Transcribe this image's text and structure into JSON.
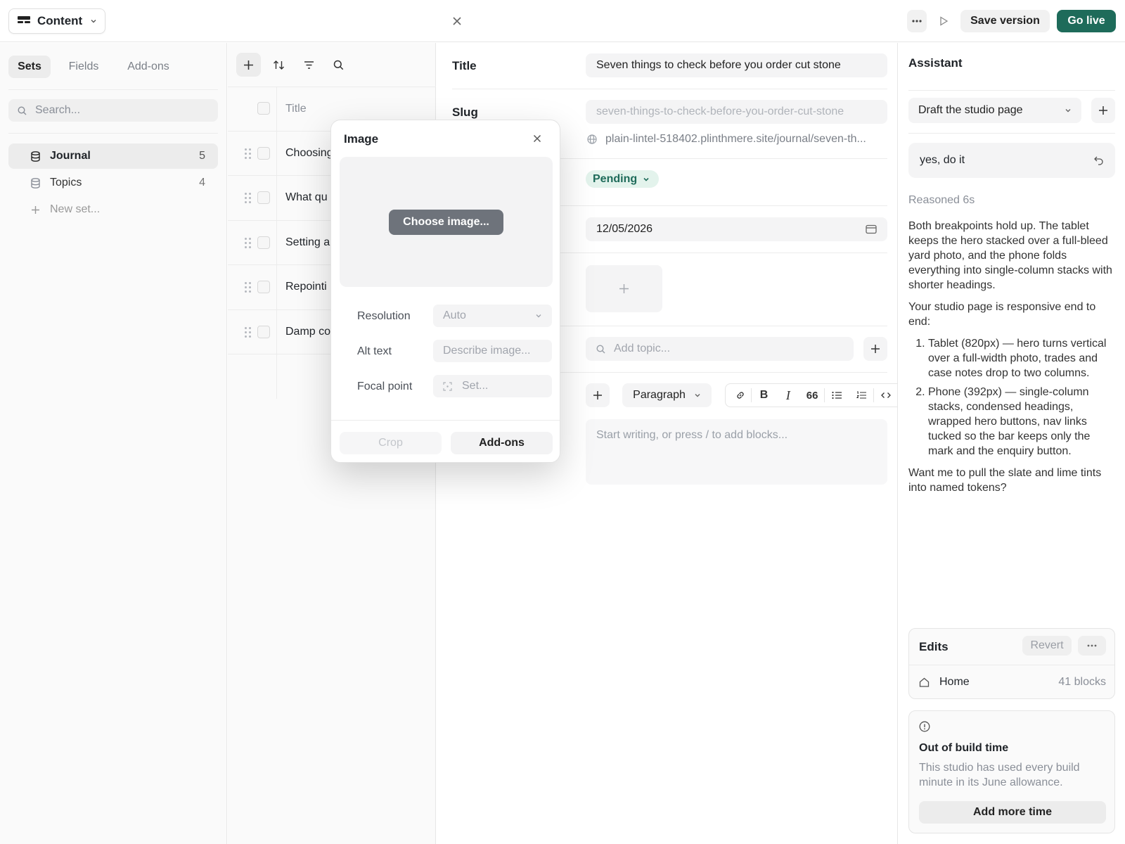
{
  "topbar": {
    "content_label": "Content",
    "save_version": "Save version",
    "go_live": "Go live"
  },
  "sidebar": {
    "tabs": [
      "Sets",
      "Fields",
      "Add-ons"
    ],
    "search_placeholder": "Search...",
    "items": [
      {
        "label": "Journal",
        "count": "5"
      },
      {
        "label": "Topics",
        "count": "4"
      }
    ],
    "new_set": "New set..."
  },
  "list": {
    "header_title": "Title",
    "rows": [
      "Choosing",
      "What qu",
      "Setting a",
      "Repointi",
      "Damp co"
    ]
  },
  "editor": {
    "title_label": "Title",
    "title_value": "Seven things to check before you order cut stone",
    "slug_label": "Slug",
    "slug_value": "seven-things-to-check-before-you-order-cut-stone",
    "url": "plain-lintel-518402.plinthmere.site/journal/seven-th...",
    "status": "Pending",
    "date": "12/05/2026",
    "topic_placeholder": "Add topic...",
    "block_type": "Paragraph",
    "quote_glyph": "66",
    "body_placeholder": "Start writing, or press / to add blocks..."
  },
  "modal": {
    "title": "Image",
    "choose_image": "Choose image...",
    "resolution_label": "Resolution",
    "resolution_value": "Auto",
    "alt_label": "Alt text",
    "alt_placeholder": "Describe image...",
    "focal_label": "Focal point",
    "focal_value": "Set...",
    "crop": "Crop",
    "addons": "Add-ons"
  },
  "assistant": {
    "title": "Assistant",
    "thread": "Draft the studio page",
    "user_message": "yes, do it",
    "reasoned": "Reasoned 6s",
    "para1": "Both breakpoints hold up. The tablet keeps the hero stacked over a full-bleed yard photo, and the phone folds everything into single-column stacks with shorter headings.",
    "para2": "Your studio page is responsive end to end:",
    "list": [
      "Tablet (820px) — hero turns vertical over a full-width photo, trades and case notes drop to two columns.",
      "Phone (392px) — single-column stacks, condensed headings, wrapped hero buttons, nav links tucked so the bar keeps only the mark and the enquiry button."
    ],
    "para3": "Want me to pull the slate and lime tints into named tokens?",
    "edits_title": "Edits",
    "revert": "Revert",
    "edit_page": "Home",
    "edit_blocks": "41 blocks",
    "notice_title": "Out of build time",
    "notice_text": "This studio has used every build minute in its June allowance.",
    "add_time": "Add more time"
  },
  "colors": {
    "accent": "#1e6b5a",
    "pending_bg": "#e3f3ec",
    "pending_text": "#1e6b5a"
  }
}
